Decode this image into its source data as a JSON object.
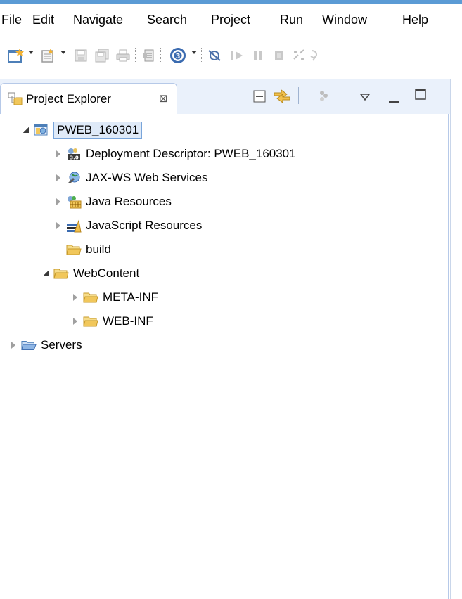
{
  "menubar": {
    "items": [
      "File",
      "Edit",
      "Navigate",
      "Search",
      "Project",
      "Run",
      "Window",
      "Help"
    ]
  },
  "toolbar": {
    "buttons": [
      {
        "icon": "new-wizard-icon"
      },
      {
        "icon": "new-icon"
      },
      {
        "icon": "save-icon"
      },
      {
        "icon": "save-all-icon"
      },
      {
        "icon": "print-icon"
      },
      {
        "icon": "publish-icon"
      },
      {
        "icon": "run-target-icon"
      },
      {
        "icon": "skip-breakpoints-icon"
      },
      {
        "icon": "resume-icon"
      },
      {
        "icon": "suspend-icon"
      },
      {
        "icon": "terminate-icon"
      },
      {
        "icon": "disconnect-icon"
      }
    ]
  },
  "view": {
    "title": "Project Explorer",
    "close_symbol": "⊠"
  },
  "tree": {
    "nodes": [
      {
        "label": "PWEB_160301",
        "icon": "web-project-icon",
        "state": "expanded",
        "selected": true
      },
      {
        "label": "Deployment Descriptor: PWEB_160301",
        "icon": "deployment-descriptor-icon",
        "state": "collapsed"
      },
      {
        "label": "JAX-WS Web Services",
        "icon": "web-services-icon",
        "state": "collapsed"
      },
      {
        "label": "Java Resources",
        "icon": "java-resources-icon",
        "state": "collapsed"
      },
      {
        "label": "JavaScript Resources",
        "icon": "javascript-resources-icon",
        "state": "collapsed"
      },
      {
        "label": "build",
        "icon": "folder-icon",
        "state": "none"
      },
      {
        "label": "WebContent",
        "icon": "folder-icon",
        "state": "expanded"
      },
      {
        "label": "META-INF",
        "icon": "folder-icon",
        "state": "collapsed"
      },
      {
        "label": "WEB-INF",
        "icon": "folder-icon",
        "state": "collapsed"
      },
      {
        "label": "Servers",
        "icon": "servers-folder-icon",
        "state": "collapsed"
      }
    ]
  },
  "colors": {
    "accent": "#5b9bd5",
    "view_header": "#eaf1fb",
    "selection": "#dfeaf8",
    "folder": "#e8c25a"
  }
}
